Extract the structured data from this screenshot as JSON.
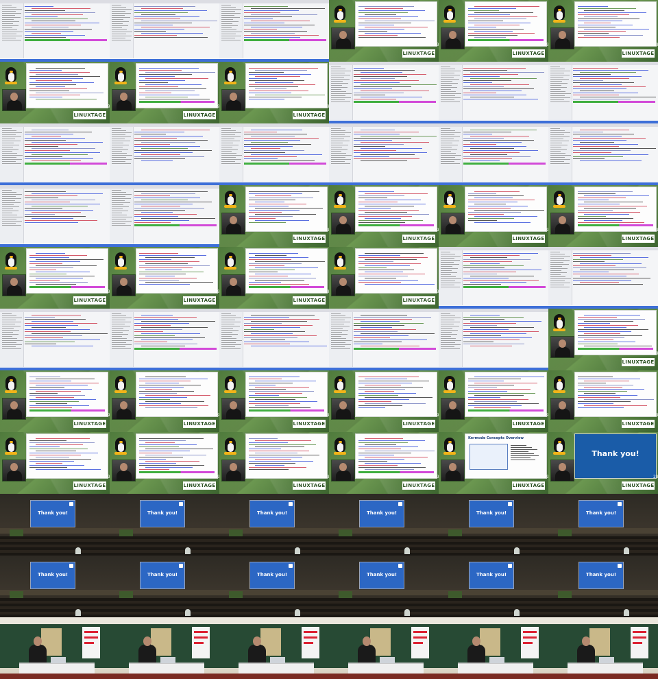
{
  "brand_label": "LINUXTAGE",
  "slide_number": "29",
  "thank_you_text": "Thank you!",
  "overview_title": "Kermode Concepts Overview",
  "rows": [
    [
      "s",
      "s",
      "s",
      "g",
      "g",
      "g"
    ],
    [
      "g",
      "g",
      "g",
      "s",
      "s",
      "s"
    ],
    [
      "s",
      "s",
      "s",
      "s",
      "s",
      "s"
    ],
    [
      "s",
      "s",
      "g",
      "g",
      "g",
      "g"
    ],
    [
      "g",
      "g",
      "g",
      "g",
      "s",
      "s"
    ],
    [
      "s",
      "s",
      "s",
      "s",
      "s",
      "g"
    ],
    [
      "g",
      "g",
      "g",
      "g",
      "g",
      "g"
    ],
    [
      "g",
      "g",
      "g",
      "g",
      "go",
      "gt"
    ],
    [
      "a",
      "a",
      "a",
      "a",
      "a",
      "a"
    ],
    [
      "a",
      "a",
      "a",
      "a",
      "a",
      "a"
    ],
    [
      "p",
      "p",
      "p",
      "p",
      "p",
      "p"
    ]
  ],
  "colors": {
    "conference_green": "#4f7a3c",
    "screen_blue": "#2c67c4",
    "tux_yellow": "#f2b418"
  }
}
